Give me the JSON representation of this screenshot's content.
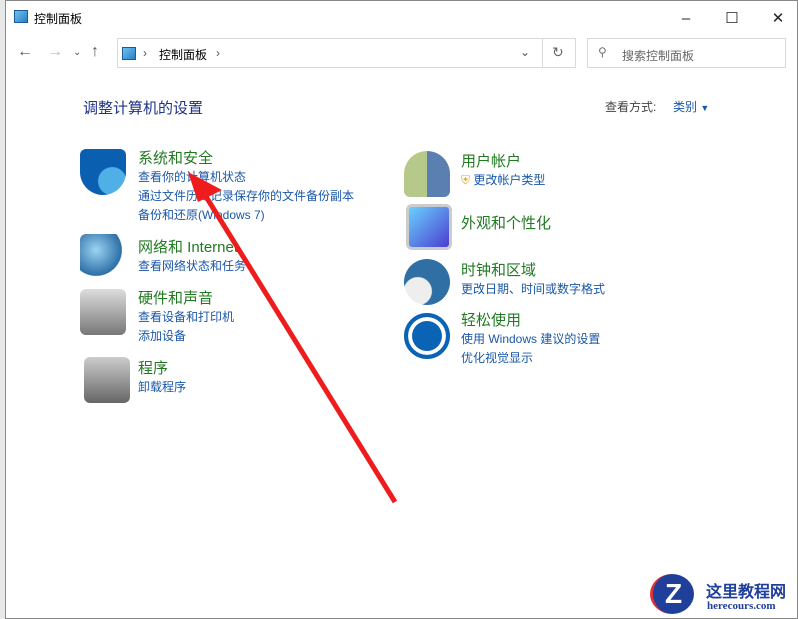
{
  "window": {
    "title": "控制面板"
  },
  "address": {
    "crumb": "控制面板",
    "search_placeholder": "搜索控制面板"
  },
  "main": {
    "heading": "调整计算机的设置",
    "view_label": "查看方式:",
    "view_value": "类别"
  },
  "left": [
    {
      "title": "系统和安全",
      "links": [
        "查看你的计算机状态",
        "通过文件历史记录保存你的文件备份副本",
        "备份和还原(Windows 7)"
      ]
    },
    {
      "title": "网络和 Internet",
      "links": [
        "查看网络状态和任务"
      ]
    },
    {
      "title": "硬件和声音",
      "links": [
        "查看设备和打印机",
        "添加设备"
      ]
    },
    {
      "title": "程序",
      "links": [
        "卸载程序"
      ]
    }
  ],
  "right": [
    {
      "title": "用户帐户",
      "links": [
        "更改帐户类型"
      ]
    },
    {
      "title": "外观和个性化",
      "links": []
    },
    {
      "title": "时钟和区域",
      "links": [
        "更改日期、时间或数字格式"
      ]
    },
    {
      "title": "轻松使用",
      "links": [
        "使用 Windows 建议的设置",
        "优化视觉显示"
      ]
    }
  ],
  "watermark": {
    "name": "这里教程网",
    "url": "herecours.com"
  }
}
